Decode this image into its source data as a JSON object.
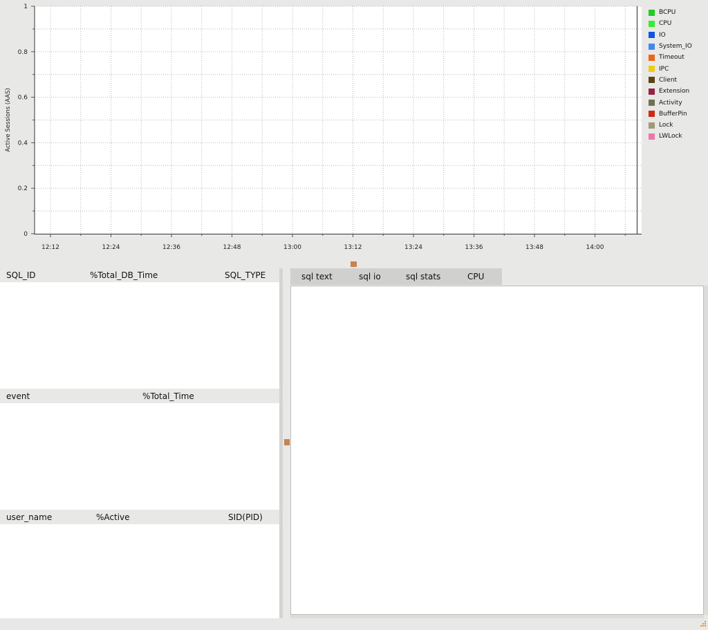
{
  "chart_data": {
    "type": "area",
    "xlabel": "",
    "ylabel": "Active Sessions (AAS)",
    "x_ticks": [
      "12:12",
      "12:24",
      "12:36",
      "12:48",
      "13:00",
      "13:12",
      "13:24",
      "13:36",
      "13:48",
      "14:00"
    ],
    "y_ticks": [
      "0",
      "0.2",
      "0.4",
      "0.6",
      "0.8",
      "1"
    ],
    "ylim": [
      0,
      1
    ],
    "grid": true,
    "legend_position": "right",
    "series": [
      {
        "name": "BCPU",
        "color": "#22cc22",
        "values": []
      },
      {
        "name": "CPU",
        "color": "#33ee33",
        "values": []
      },
      {
        "name": "IO",
        "color": "#1155dd",
        "values": []
      },
      {
        "name": "System_IO",
        "color": "#4488ee",
        "values": []
      },
      {
        "name": "Timeout",
        "color": "#ee6611",
        "values": []
      },
      {
        "name": "IPC",
        "color": "#eecc11",
        "values": []
      },
      {
        "name": "Client",
        "color": "#5a4411",
        "values": []
      },
      {
        "name": "Extension",
        "color": "#992244",
        "values": []
      },
      {
        "name": "Activity",
        "color": "#6f7355",
        "values": []
      },
      {
        "name": "BufferPin",
        "color": "#cc2a11",
        "values": []
      },
      {
        "name": "Lock",
        "color": "#a09a77",
        "values": []
      },
      {
        "name": "LWLock",
        "color": "#ee77aa",
        "values": []
      }
    ]
  },
  "sql_table": {
    "col1": "SQL_ID",
    "col2": "%Total_DB_Time",
    "col3": "SQL_TYPE"
  },
  "event_table": {
    "col1": "event",
    "col2": "%Total_Time"
  },
  "user_table": {
    "col1": "user_name",
    "col2": "%Active",
    "col3": "SID(PID)"
  },
  "tabs": [
    "sql text",
    "sql io",
    "sql stats",
    "CPU"
  ],
  "colors": {
    "handle": "#c8834f",
    "grip": "#f08a20"
  }
}
